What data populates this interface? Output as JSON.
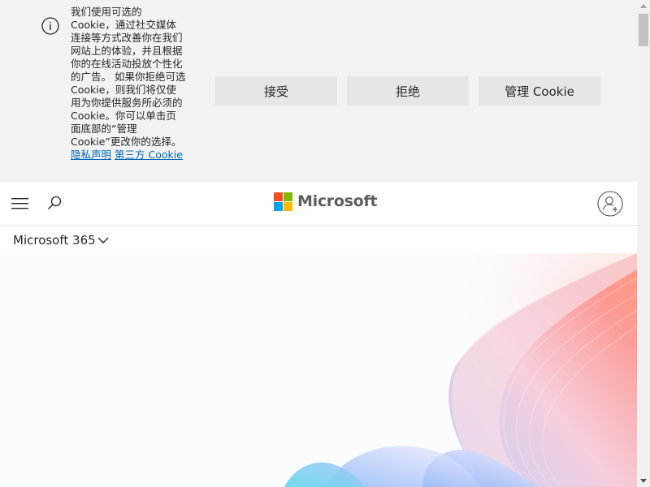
{
  "cookie_banner": {
    "text": "我们使用可选的 Cookie，通过社交媒体连接等方式改善你在我们网站上的体验，并且根据你的在线活动投放个性化的广告。 如果你拒绝可选 Cookie，则我们将仅使用为你提供服务所必须的 Cookie。你可以单击页面底部的“管理 Cookie”更改你的选择。",
    "privacy_link": "隐私声明",
    "third_party_link": "第三方 Cookie",
    "accept_label": "接受",
    "reject_label": "拒绝",
    "manage_label": "管理 Cookie"
  },
  "header": {
    "brand_name": "Microsoft",
    "icons": [
      "hamburger-menu-icon",
      "search-icon",
      "microsoft-logo",
      "account-icon"
    ]
  },
  "subnav": {
    "label": "Microsoft 365",
    "icon": "chevron-down-icon"
  },
  "colors": {
    "banner_bg": "#f2f2f2",
    "button_bg": "#e6e6e6",
    "link": "#0067b8",
    "logo_red": "#f25022",
    "logo_green": "#7fba00",
    "logo_blue": "#00a4ef",
    "logo_yellow": "#ffb900"
  }
}
